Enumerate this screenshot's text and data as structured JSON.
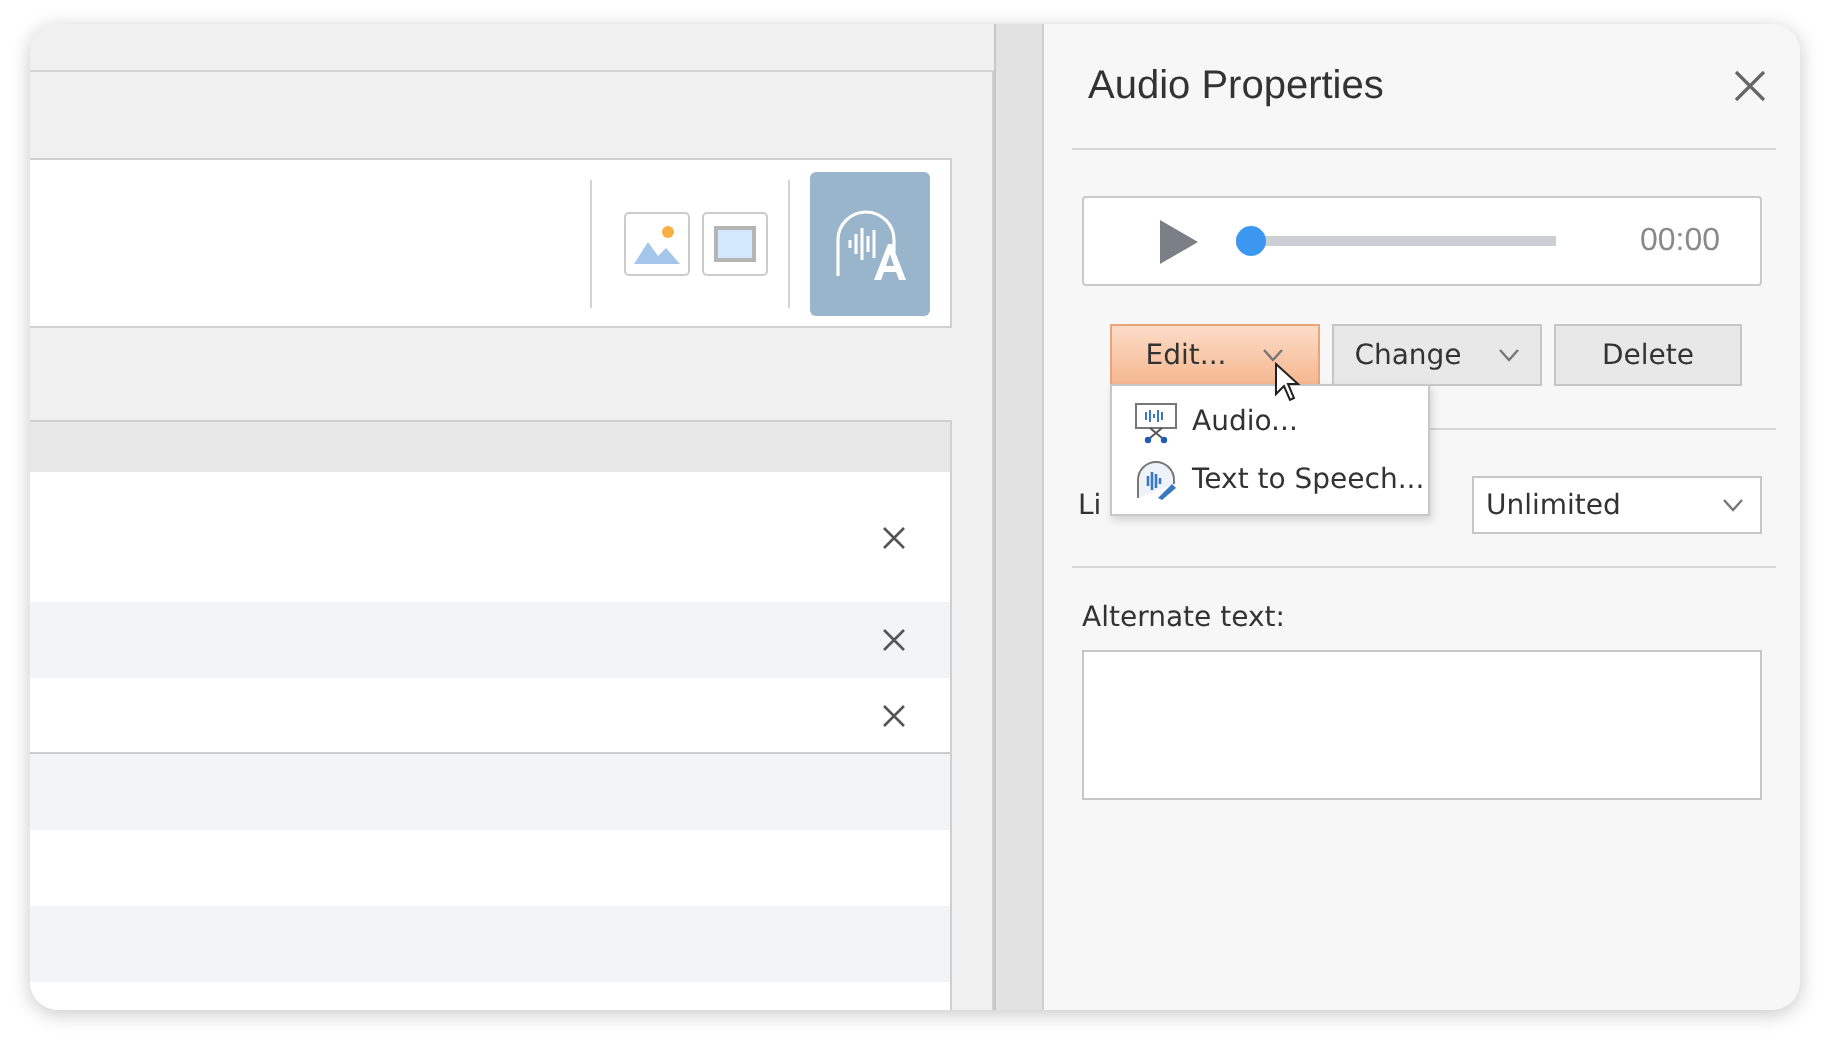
{
  "list": {
    "rows": [
      {
        "removable": true
      },
      {
        "removable": true
      },
      {
        "removable": true
      },
      {
        "removable": false
      },
      {
        "removable": false
      },
      {
        "removable": false
      },
      {
        "removable": false
      }
    ]
  },
  "panel": {
    "title": "Audio Properties",
    "player": {
      "level": 0,
      "time": "00:00"
    },
    "buttons": [
      {
        "label": "Edit...",
        "kind": "split",
        "pressed": true
      },
      {
        "label": "Change",
        "kind": "split",
        "pressed": false
      },
      {
        "label": "Delete",
        "kind": "plain",
        "pressed": false
      }
    ],
    "menu": {
      "items": [
        {
          "label": "Audio...",
          "kind": "audio"
        },
        {
          "label": "Text to Speech...",
          "kind": "speech"
        }
      ]
    },
    "limit": {
      "label": "Li",
      "value": "Unlimited"
    },
    "alternate_text": {
      "label": "Alternate text:"
    }
  }
}
